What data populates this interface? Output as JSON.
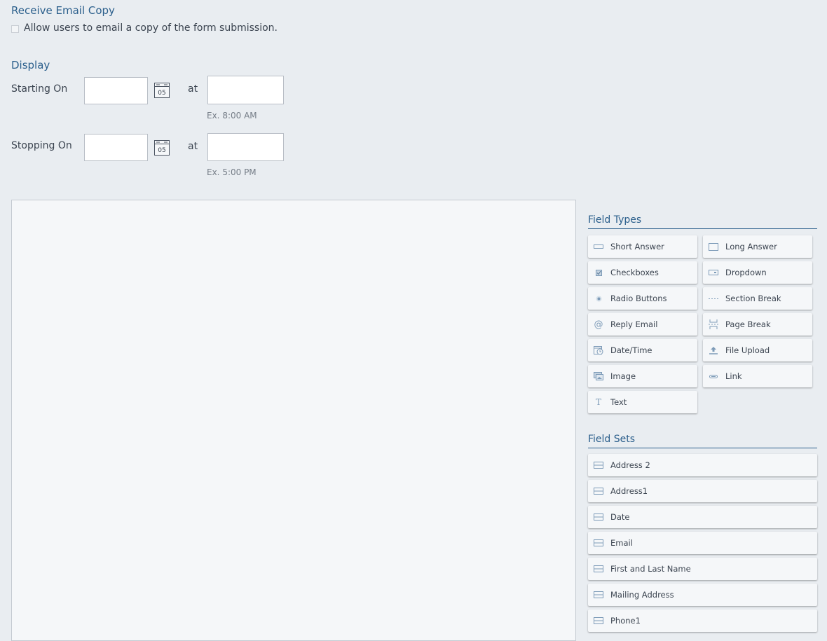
{
  "email_copy": {
    "title": "Receive Email Copy",
    "checkbox_label": "Allow users to email a copy of the form submission."
  },
  "display": {
    "title": "Display",
    "starting": {
      "label": "Starting On",
      "at": "at",
      "date_value": "",
      "time_value": "",
      "calendar_day": "05",
      "hint": "Ex. 8:00 AM"
    },
    "stopping": {
      "label": "Stopping On",
      "at": "at",
      "date_value": "",
      "time_value": "",
      "calendar_day": "05",
      "hint": "Ex. 5:00 PM"
    }
  },
  "field_types": {
    "title": "Field Types",
    "items": [
      {
        "label": "Short Answer",
        "icon": "short-answer-icon"
      },
      {
        "label": "Long Answer",
        "icon": "long-answer-icon"
      },
      {
        "label": "Checkboxes",
        "icon": "checkbox-icon"
      },
      {
        "label": "Dropdown",
        "icon": "dropdown-icon"
      },
      {
        "label": "Radio Buttons",
        "icon": "radio-icon"
      },
      {
        "label": "Section Break",
        "icon": "section-break-icon"
      },
      {
        "label": "Reply Email",
        "icon": "at-icon"
      },
      {
        "label": "Page Break",
        "icon": "page-break-icon"
      },
      {
        "label": "Date/Time",
        "icon": "calendar-clock-icon"
      },
      {
        "label": "File Upload",
        "icon": "upload-icon"
      },
      {
        "label": "Image",
        "icon": "image-icon"
      },
      {
        "label": "Link",
        "icon": "link-icon"
      },
      {
        "label": "Text",
        "icon": "text-icon"
      }
    ]
  },
  "field_sets": {
    "title": "Field Sets",
    "items": [
      {
        "label": "Address 2"
      },
      {
        "label": "Address1"
      },
      {
        "label": "Date"
      },
      {
        "label": "Email"
      },
      {
        "label": "First and Last Name"
      },
      {
        "label": "Mailing Address"
      },
      {
        "label": "Phone1"
      }
    ]
  },
  "colors": {
    "accent": "#2b5f8c",
    "background": "#e9edf1",
    "icon": "#7d9bb8"
  }
}
